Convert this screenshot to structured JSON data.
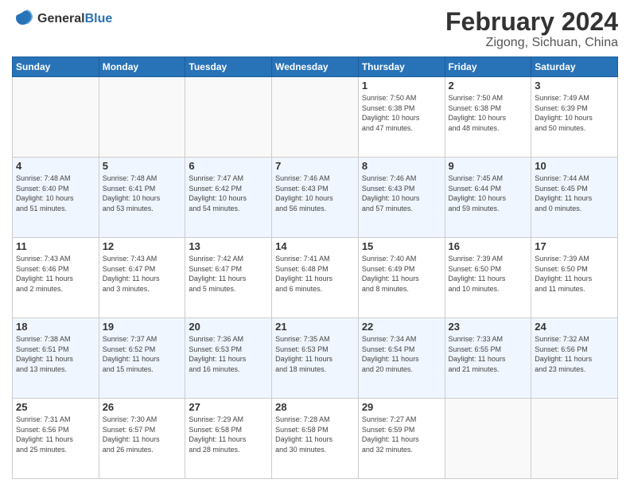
{
  "logo": {
    "line1": "General",
    "line2": "Blue"
  },
  "title": "February 2024",
  "subtitle": "Zigong, Sichuan, China",
  "days_of_week": [
    "Sunday",
    "Monday",
    "Tuesday",
    "Wednesday",
    "Thursday",
    "Friday",
    "Saturday"
  ],
  "weeks": [
    [
      {
        "day": "",
        "info": ""
      },
      {
        "day": "",
        "info": ""
      },
      {
        "day": "",
        "info": ""
      },
      {
        "day": "",
        "info": ""
      },
      {
        "day": "1",
        "info": "Sunrise: 7:50 AM\nSunset: 6:38 PM\nDaylight: 10 hours\nand 47 minutes."
      },
      {
        "day": "2",
        "info": "Sunrise: 7:50 AM\nSunset: 6:38 PM\nDaylight: 10 hours\nand 48 minutes."
      },
      {
        "day": "3",
        "info": "Sunrise: 7:49 AM\nSunset: 6:39 PM\nDaylight: 10 hours\nand 50 minutes."
      }
    ],
    [
      {
        "day": "4",
        "info": "Sunrise: 7:48 AM\nSunset: 6:40 PM\nDaylight: 10 hours\nand 51 minutes."
      },
      {
        "day": "5",
        "info": "Sunrise: 7:48 AM\nSunset: 6:41 PM\nDaylight: 10 hours\nand 53 minutes."
      },
      {
        "day": "6",
        "info": "Sunrise: 7:47 AM\nSunset: 6:42 PM\nDaylight: 10 hours\nand 54 minutes."
      },
      {
        "day": "7",
        "info": "Sunrise: 7:46 AM\nSunset: 6:43 PM\nDaylight: 10 hours\nand 56 minutes."
      },
      {
        "day": "8",
        "info": "Sunrise: 7:46 AM\nSunset: 6:43 PM\nDaylight: 10 hours\nand 57 minutes."
      },
      {
        "day": "9",
        "info": "Sunrise: 7:45 AM\nSunset: 6:44 PM\nDaylight: 10 hours\nand 59 minutes."
      },
      {
        "day": "10",
        "info": "Sunrise: 7:44 AM\nSunset: 6:45 PM\nDaylight: 11 hours\nand 0 minutes."
      }
    ],
    [
      {
        "day": "11",
        "info": "Sunrise: 7:43 AM\nSunset: 6:46 PM\nDaylight: 11 hours\nand 2 minutes."
      },
      {
        "day": "12",
        "info": "Sunrise: 7:43 AM\nSunset: 6:47 PM\nDaylight: 11 hours\nand 3 minutes."
      },
      {
        "day": "13",
        "info": "Sunrise: 7:42 AM\nSunset: 6:47 PM\nDaylight: 11 hours\nand 5 minutes."
      },
      {
        "day": "14",
        "info": "Sunrise: 7:41 AM\nSunset: 6:48 PM\nDaylight: 11 hours\nand 6 minutes."
      },
      {
        "day": "15",
        "info": "Sunrise: 7:40 AM\nSunset: 6:49 PM\nDaylight: 11 hours\nand 8 minutes."
      },
      {
        "day": "16",
        "info": "Sunrise: 7:39 AM\nSunset: 6:50 PM\nDaylight: 11 hours\nand 10 minutes."
      },
      {
        "day": "17",
        "info": "Sunrise: 7:39 AM\nSunset: 6:50 PM\nDaylight: 11 hours\nand 11 minutes."
      }
    ],
    [
      {
        "day": "18",
        "info": "Sunrise: 7:38 AM\nSunset: 6:51 PM\nDaylight: 11 hours\nand 13 minutes."
      },
      {
        "day": "19",
        "info": "Sunrise: 7:37 AM\nSunset: 6:52 PM\nDaylight: 11 hours\nand 15 minutes."
      },
      {
        "day": "20",
        "info": "Sunrise: 7:36 AM\nSunset: 6:53 PM\nDaylight: 11 hours\nand 16 minutes."
      },
      {
        "day": "21",
        "info": "Sunrise: 7:35 AM\nSunset: 6:53 PM\nDaylight: 11 hours\nand 18 minutes."
      },
      {
        "day": "22",
        "info": "Sunrise: 7:34 AM\nSunset: 6:54 PM\nDaylight: 11 hours\nand 20 minutes."
      },
      {
        "day": "23",
        "info": "Sunrise: 7:33 AM\nSunset: 6:55 PM\nDaylight: 11 hours\nand 21 minutes."
      },
      {
        "day": "24",
        "info": "Sunrise: 7:32 AM\nSunset: 6:56 PM\nDaylight: 11 hours\nand 23 minutes."
      }
    ],
    [
      {
        "day": "25",
        "info": "Sunrise: 7:31 AM\nSunset: 6:56 PM\nDaylight: 11 hours\nand 25 minutes."
      },
      {
        "day": "26",
        "info": "Sunrise: 7:30 AM\nSunset: 6:57 PM\nDaylight: 11 hours\nand 26 minutes."
      },
      {
        "day": "27",
        "info": "Sunrise: 7:29 AM\nSunset: 6:58 PM\nDaylight: 11 hours\nand 28 minutes."
      },
      {
        "day": "28",
        "info": "Sunrise: 7:28 AM\nSunset: 6:58 PM\nDaylight: 11 hours\nand 30 minutes."
      },
      {
        "day": "29",
        "info": "Sunrise: 7:27 AM\nSunset: 6:59 PM\nDaylight: 11 hours\nand 32 minutes."
      },
      {
        "day": "",
        "info": ""
      },
      {
        "day": "",
        "info": ""
      }
    ]
  ]
}
